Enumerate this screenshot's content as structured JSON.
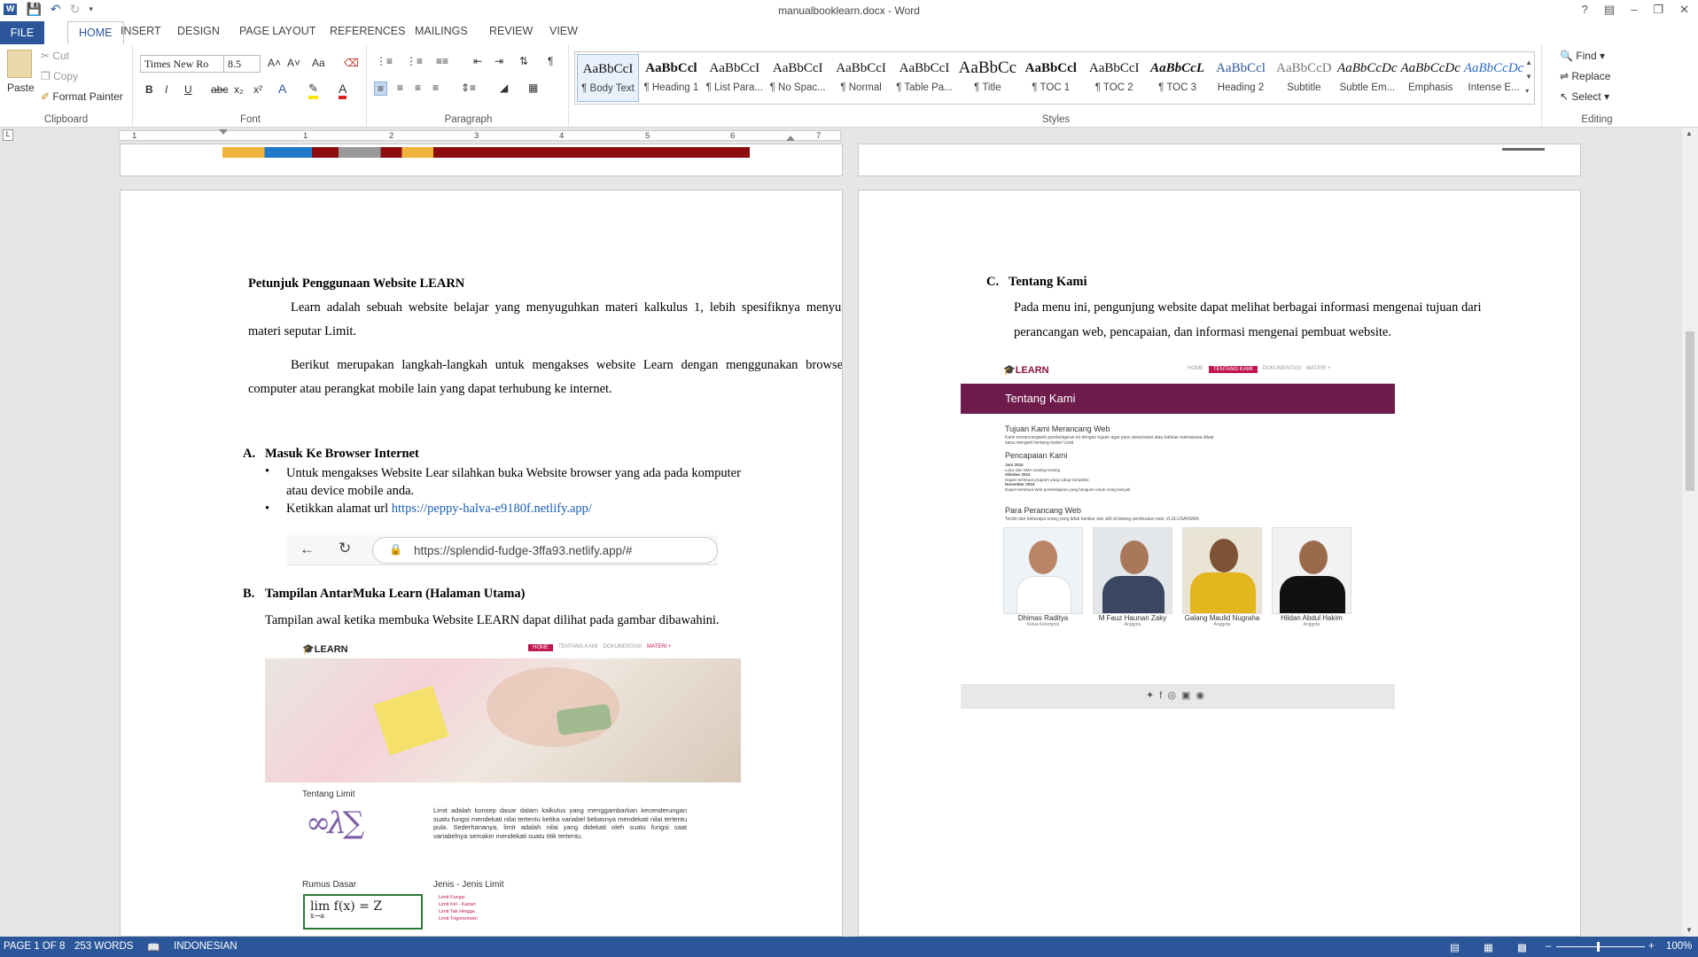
{
  "window": {
    "title": "manualbooklearn.docx - Word",
    "help": "?"
  },
  "tabs": {
    "file": "FILE",
    "home": "HOME",
    "insert": "INSERT",
    "design": "DESIGN",
    "page_layout": "PAGE LAYOUT",
    "references": "REFERENCES",
    "mailings": "MAILINGS",
    "review": "REVIEW",
    "view": "VIEW"
  },
  "clipboard": {
    "paste": "Paste",
    "cut": "Cut",
    "copy": "Copy",
    "format_painter": "Format Painter",
    "label": "Clipboard"
  },
  "font": {
    "name": "Times New Ro",
    "size": "8.5",
    "label": "Font",
    "bold": "B",
    "italic": "I",
    "underline": "U",
    "strike": "abc",
    "sub": "x₂",
    "sup": "x²",
    "grow": "A˄",
    "shrink": "A˅",
    "case": "Aa"
  },
  "paragraph": {
    "label": "Paragraph",
    "pilcrow": "¶"
  },
  "styles": {
    "label": "Styles",
    "items": [
      {
        "preview": "AaBbCcI",
        "name": "¶ Body Text"
      },
      {
        "preview": "AaBbCcl",
        "name": "¶ Heading 1"
      },
      {
        "preview": "AaBbCcI",
        "name": "¶ List Para..."
      },
      {
        "preview": "AaBbCcI",
        "name": "¶ No Spac..."
      },
      {
        "preview": "AaBbCcI",
        "name": "¶ Normal"
      },
      {
        "preview": "AaBbCcI",
        "name": "¶ Table Pa..."
      },
      {
        "preview": "AaBbCc",
        "name": "¶ Title"
      },
      {
        "preview": "AaBbCcl",
        "name": "¶ TOC 1"
      },
      {
        "preview": "AaBbCcI",
        "name": "¶ TOC 2"
      },
      {
        "preview": "AaBbCcL",
        "name": "¶ TOC 3"
      },
      {
        "preview": "AaBbCcl",
        "name": "Heading 2"
      },
      {
        "preview": "AaBbCcD",
        "name": "Subtitle"
      },
      {
        "preview": "AaBbCcDc",
        "name": "Subtle Em..."
      },
      {
        "preview": "AaBbCcDc",
        "name": "Emphasis"
      },
      {
        "preview": "AaBbCcDc",
        "name": "Intense E..."
      }
    ]
  },
  "editing": {
    "label": "Editing",
    "find": "Find",
    "replace": "Replace",
    "select": "Select"
  },
  "ruler": {
    "marks": [
      "1",
      "1",
      "2",
      "3",
      "4",
      "5",
      "6",
      "7"
    ]
  },
  "page1": {
    "heading": "Petunjuk Penggunaan Website LEARN",
    "para1": "Learn adalah sebuah website belajar yang menyuguhkan materi kalkulus 1, lebih spesifiknya menyuguhkan materi seputar Limit.",
    "para2": "Berikut merupakan langkah-langkah untuk mengakses website Learn dengan menggunakan browser pada computer atau perangkat mobile lain yang dapat terhubung ke internet.",
    "secA_letter": "A.",
    "secA_title": "Masuk Ke Browser Internet",
    "bullet1": "Untuk mengakses Website Lear silahkan buka Website browser yang ada pada komputer atau device mobile anda.",
    "bullet2_prefix": "Ketikkan alamat url ",
    "bullet2_link": "https://peppy-halva-e9180f.netlify.app/",
    "address_bar": "https://splendid-fudge-3ffa93.netlify.app/#",
    "secB_letter": "B.",
    "secB_title": "Tampilan AntarMuka Learn (Halaman Utama)",
    "secB_text": "Tampilan awal ketika membuka Website LEARN dapat dilihat pada gambar dibawahini.",
    "shot": {
      "logo": "LEARN",
      "nav": [
        "HOME",
        "TENTANG KAMI",
        "DOKUMENTASI",
        "MATERI +"
      ],
      "tentang": "Tentang Limit",
      "body": "Limit adalah konsep dasar dalam kalkulus yang menggambarkan kecenderungan suatu fungsi mendekati nilai tertentu ketika variabel bebasnya mendekati nilai tertentu pula. Sederhananya, limit adalah nilai yang didekati oleh suatu fungsi saat variabelnya semakin mendekati suatu titik tertentu.",
      "rumus": "Rumus Dasar",
      "jenis": "Jenis - Jenis Limit",
      "formula": "lim f(x) = Z",
      "formula_sub": "x→a",
      "jenis_items": [
        "Limit Fungsi",
        "Limit Kiri - Kanan",
        "Limit Tak Hingga",
        "Limit Trigonometri"
      ]
    }
  },
  "page2": {
    "secC_letter": "C.",
    "secC_title": "Tentang Kami",
    "secC_text": "Pada menu ini, pengunjung website dapat melihat berbagai informasi mengenai tujuan dari perancangan web, pencapaian, dan informasi mengenai pembuat website.",
    "shot": {
      "logo": "LEARN",
      "nav": [
        "HOME",
        "TENTANG KAMI",
        "DOKUMENTASI",
        "MATERI +"
      ],
      "banner": "Tentang Kami",
      "h1": "Tujuan Kami Merancang Web",
      "p1": "Kami merancangweb pembelajaran ini dengan tujuan agar para siswa/siswi atau bahkan mahasiswa diluar sana mengerti tentang materi Limit.",
      "h2": "Pencapaian Kami",
      "a1": "Juni 2024",
      "a1t": "Lulus dari SMA masing-masing",
      "a2": "Oktober 2024",
      "a2t": "Dapat membuat program yang cukup kompleks",
      "a3": "November 2024",
      "a3t": "Dapat membuat Web pembelajaran yang bangune untuk orang banyak",
      "h3": "Para Perancang Web",
      "p3": "Terdiri dari beberapa orang yang tidak familiar dan ahli di bidang pembuatan web. #LULUSANSMA",
      "members": [
        {
          "name": "Dhimas Raditya",
          "role": "Ketua Kelompok"
        },
        {
          "name": "M Fauz Haunan Zaky",
          "role": "Anggota"
        },
        {
          "name": "Galang Maulid Nugraha",
          "role": "Anggota"
        },
        {
          "name": "Hildan Abdul Hakim",
          "role": "Anggota"
        }
      ]
    }
  },
  "status": {
    "page": "PAGE 1 OF 8",
    "words": "253 WORDS",
    "language": "INDONESIAN",
    "zoom": "100%"
  }
}
